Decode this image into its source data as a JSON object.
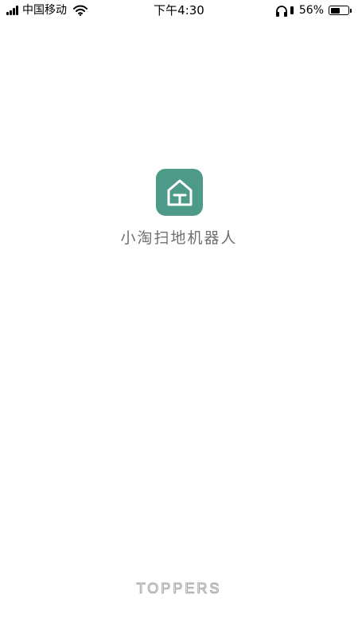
{
  "status_bar": {
    "carrier": "中国移动",
    "time": "下午4:30",
    "battery_percent_label": "56%",
    "battery_level": 0.56,
    "icons": [
      "signal-icon",
      "wifi-icon",
      "headphone-icon",
      "battery-icon"
    ]
  },
  "splash": {
    "app_name": "小淘扫地机器人",
    "icon": "home-icon",
    "icon_color": "#4d9a88"
  },
  "footer": {
    "brand": "TOPPERS"
  }
}
